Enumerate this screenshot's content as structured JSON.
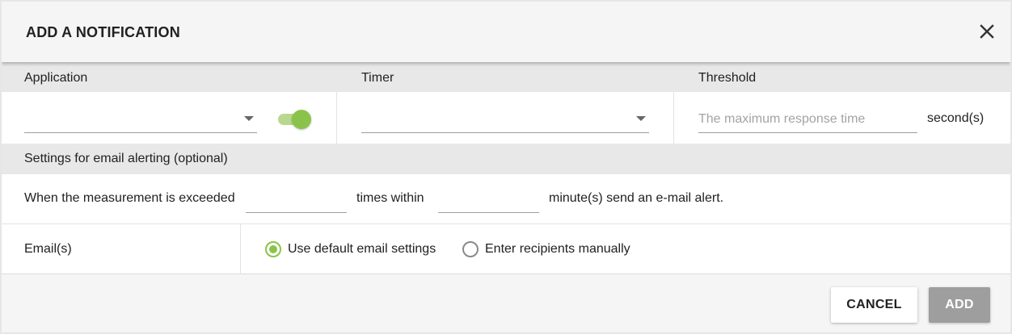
{
  "dialog": {
    "title": "ADD A NOTIFICATION"
  },
  "columns": {
    "application_label": "Application",
    "timer_label": "Timer",
    "threshold_label": "Threshold"
  },
  "fields": {
    "application_value": "",
    "toggle_on": true,
    "timer_value": "",
    "threshold_placeholder": "The maximum response time",
    "threshold_unit": "second(s)"
  },
  "email_alerting": {
    "section_label": "Settings for email alerting (optional)",
    "text_before": "When the measurement is exceeded",
    "text_middle": "times within",
    "text_after": "minute(s) send an e-mail alert.",
    "times_value": "",
    "minutes_value": ""
  },
  "emails": {
    "label": "Email(s)",
    "options": [
      {
        "label": "Use default email settings",
        "checked": true
      },
      {
        "label": "Enter recipients manually",
        "checked": false
      }
    ]
  },
  "footer": {
    "cancel_label": "CANCEL",
    "add_label": "ADD"
  },
  "colors": {
    "accent": "#8bc34a",
    "accent_track": "#b8d88f",
    "disabled_button": "#9e9e9e",
    "header_bg": "#f5f5f5",
    "band_bg": "#e8e8e8"
  },
  "icons": {
    "close": "close-icon",
    "dropdown": "chevron-down-icon"
  }
}
